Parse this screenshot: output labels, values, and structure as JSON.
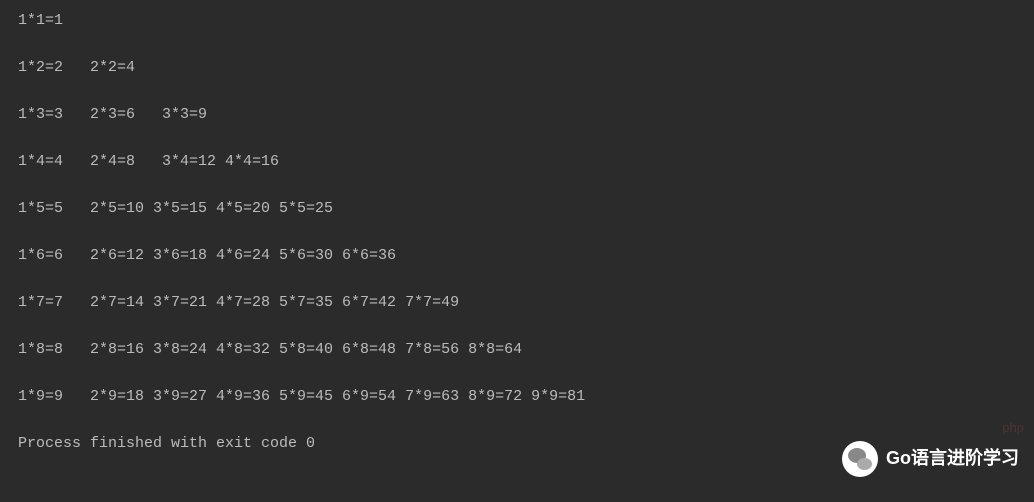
{
  "output": {
    "lines": [
      "1*1=1",
      "1*2=2   2*2=4",
      "1*3=3   2*3=6   3*3=9",
      "1*4=4   2*4=8   3*4=12 4*4=16",
      "1*5=5   2*5=10 3*5=15 4*5=20 5*5=25",
      "1*6=6   2*6=12 3*6=18 4*6=24 5*6=30 6*6=36",
      "1*7=7   2*7=14 3*7=21 4*7=28 5*7=35 6*7=42 7*7=49",
      "1*8=8   2*8=16 3*8=24 4*8=32 5*8=40 6*8=48 7*8=56 8*8=64",
      "1*9=9   2*9=18 3*9=27 4*9=36 5*9=45 6*9=54 7*9=63 8*9=72 9*9=81"
    ],
    "process_message": "Process finished with exit code 0"
  },
  "watermarks": {
    "php": "php",
    "go_label": "Go语言进阶学习"
  }
}
